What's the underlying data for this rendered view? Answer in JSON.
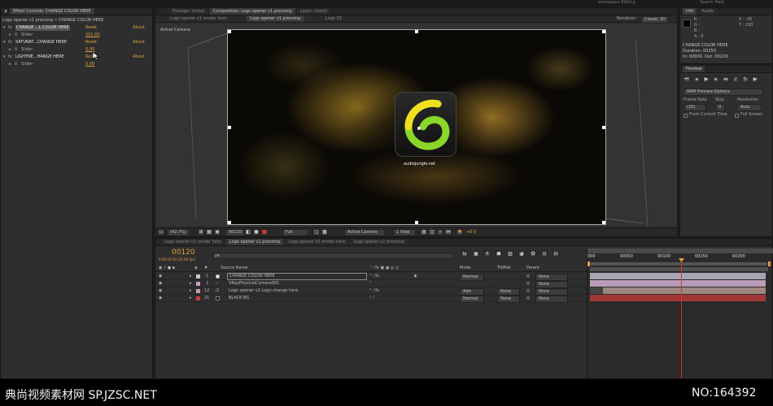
{
  "top_strip": {
    "workspace": "workspace  Editing",
    "search": "Search Help"
  },
  "effect_controls": {
    "tab": "Effect Controls: CHANGE COLOR HERE",
    "subtitle": "Logo opener v1 precomp » CHANGE COLOR HERE",
    "effects": [
      {
        "name": "CHANGE ...L COLOR HERE",
        "reset": "Reset",
        "about": "About",
        "param": "Slider",
        "value": "201.00"
      },
      {
        "name": "SATURAT...CHANGE HERE",
        "reset": "Reset",
        "about": "About",
        "param": "Slider",
        "value": "0.00"
      },
      {
        "name": "LIGHTNE...HANGE HERE",
        "reset": "Reset",
        "about": "About",
        "param": "Slider",
        "value": "0.00"
      }
    ]
  },
  "viewer": {
    "tabs": [
      "Footage: (none)",
      "Composition: Logo opener v1 precomp",
      "Layer: (none)"
    ],
    "subtabs": [
      "Logo opener v1 render here",
      "Logo opener v1 precomp",
      "Logo 01"
    ],
    "renderer_label": "Renderer:",
    "renderer_value": "Classic 3D",
    "active_camera": "Active Camera",
    "logo_site": "audiojungle.net",
    "toolbar": {
      "zoom": "(42.7%)",
      "timecode": "00120",
      "resolution": "Full",
      "view": "Active Camera",
      "views": "1 View",
      "exposure": "+0.0"
    }
  },
  "info": {
    "tabs": [
      "Info",
      "Audio"
    ],
    "r": "R :",
    "g": "G :",
    "b": "B :",
    "a": "A : 0",
    "x": "X : -35",
    "y": "Y : 293",
    "layer": "CHANGE COLOR HERE",
    "duration": "Duration: 00250",
    "in_out": "In: 00000, Out: 00229"
  },
  "preview": {
    "tab": "Preview",
    "ram_preview": "RAM Preview Options",
    "frame_rate_label": "Frame Rate",
    "skip_label": "Skip",
    "resolution_label": "Resolution",
    "frame_rate": "(25)",
    "skip": "0",
    "resolution": "Auto",
    "from_current": "From Current Time",
    "full_screen": "Full Screen"
  },
  "timeline": {
    "tabs": [
      "Logo opener v1 render here",
      "Logo opener v1 precomp",
      "Logo opener v2 render here",
      "Logo opener v2 precomp"
    ],
    "timecode": "00120",
    "timecode_sub": "0:00:04:20 (25.00 fps)",
    "search_placeholder": "ρ▾",
    "columns": {
      "num": "#",
      "source": "Source Name",
      "mode": "Mode",
      "trkmat": "TrkMat",
      "parent": "Parent"
    },
    "ruler": [
      "000",
      "00050",
      "00100",
      "00150",
      "00200"
    ],
    "layers": [
      {
        "num": "1",
        "name": "CHANGE COLOR HERE",
        "mode": "Normal",
        "trkmat": "",
        "parent": "None",
        "color": "#c8c8c8"
      },
      {
        "num": "2",
        "name": "VRayPhysicalCamera001",
        "mode": "",
        "trkmat": "",
        "parent": "None",
        "color": "#c8a0c8"
      },
      {
        "num": "12",
        "name": "Logo opener v1 Logo change here",
        "mode": "Add",
        "trkmat": "None",
        "parent": "None",
        "color": "#c8a0a0"
      },
      {
        "num": "21",
        "name": "BLACK BG",
        "mode": "Normal",
        "trkmat": "None",
        "parent": "None",
        "color": "#c83c3c"
      }
    ]
  },
  "footer": {
    "brand": "典尚视频素材网 SP.JZSC.NET",
    "number": "NO:164392"
  }
}
